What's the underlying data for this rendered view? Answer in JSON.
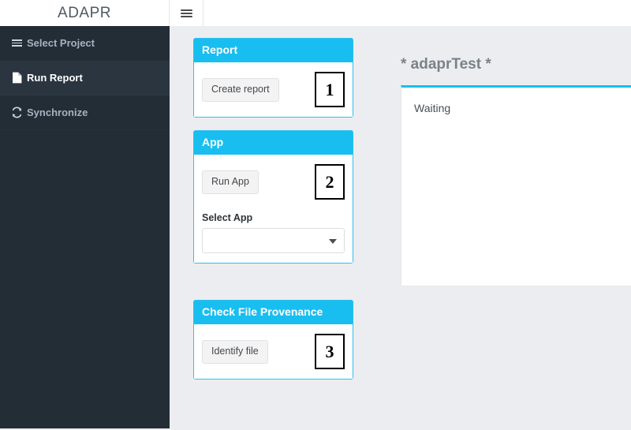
{
  "topbar": {
    "brand": "ADAPR",
    "menu_toggle_icon": "hamburger-icon"
  },
  "sidebar": {
    "items": [
      {
        "label": "Select Project",
        "icon": "hamburger-icon",
        "active": false
      },
      {
        "label": "Run Report",
        "icon": "file-document-icon",
        "active": true
      },
      {
        "label": "Synchronize",
        "icon": "refresh-sync-icon",
        "active": false
      }
    ]
  },
  "panels": [
    {
      "title": "Report",
      "button_label": "Create report",
      "callout": "1"
    },
    {
      "title": "App",
      "button_label": "Run App",
      "callout": "2",
      "select_label": "Select App",
      "select_value": "",
      "select_caret_icon": "chevron-down-icon"
    },
    {
      "title": "Check File Provenance",
      "button_label": "Identify file",
      "callout": "3"
    }
  ],
  "output": {
    "title": "* adaprTest *",
    "text": "Waiting"
  },
  "colors": {
    "accent": "#18bef0",
    "sidebar_bg": "#232d36",
    "page_bg": "#ecedf1",
    "callout_border": "#000000"
  }
}
